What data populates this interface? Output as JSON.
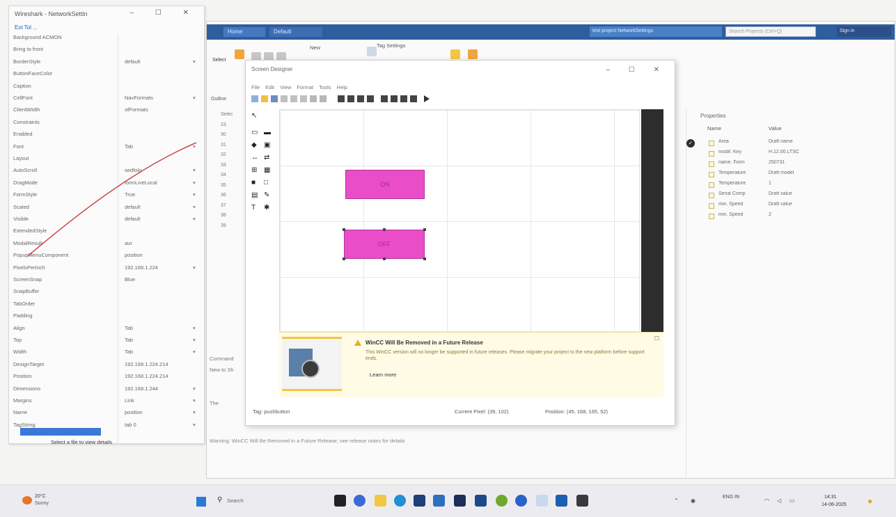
{
  "left_panel": {
    "title": "Wireshark - NetworkSettin",
    "path": "Ext Tol ...",
    "status": "Select a file to view details",
    "rows": [
      {
        "k": "Background ACMON",
        "v": "",
        "ar": ""
      },
      {
        "k": "Bring to front",
        "v": "",
        "ar": ""
      },
      {
        "k": "BorderStyle",
        "v": "default",
        "ar": "▾"
      },
      {
        "k": "ButtonFaceColor",
        "v": "",
        "ar": ""
      },
      {
        "k": "Caption",
        "v": "",
        "ar": ""
      },
      {
        "k": "CellFont",
        "v": "NavFormats",
        "ar": "▾"
      },
      {
        "k": "ClientWidth",
        "v": "ofFormats",
        "ar": ""
      },
      {
        "k": "Constraints",
        "v": "",
        "ar": ""
      },
      {
        "k": "Enabled",
        "v": "",
        "ar": ""
      },
      {
        "k": "Font",
        "v": "Tab",
        "ar": "▾"
      },
      {
        "k": "Layout",
        "v": "",
        "ar": ""
      },
      {
        "k": "AutoScroll",
        "v": "sedfolg",
        "ar": "▾"
      },
      {
        "k": "DragMode",
        "v": "formLiveLocal",
        "ar": "▾"
      },
      {
        "k": "FormStyle",
        "v": "True",
        "ar": "▾"
      },
      {
        "k": "Scaled",
        "v": "default",
        "ar": "▾"
      },
      {
        "k": "Visible",
        "v": "default",
        "ar": "▾"
      },
      {
        "k": "ExtendedStyle",
        "v": "",
        "ar": ""
      },
      {
        "k": "ModalResult",
        "v": "aur",
        "ar": ""
      },
      {
        "k": "PopupMenuComponent",
        "v": "position",
        "ar": ""
      },
      {
        "k": "PixelsPerInch",
        "v": "192.168.1.224",
        "ar": "▾"
      },
      {
        "k": "ScreenSnap",
        "v": "Blue",
        "ar": ""
      },
      {
        "k": "SnapBuffer",
        "v": "",
        "ar": ""
      },
      {
        "k": "TabOrder",
        "v": "",
        "ar": ""
      },
      {
        "k": "Padding",
        "v": "",
        "ar": ""
      },
      {
        "k": "Align",
        "v": "Tab",
        "ar": "▾"
      },
      {
        "k": "Top",
        "v": "Tab",
        "ar": "▾"
      },
      {
        "k": "Width",
        "v": "Tab",
        "ar": "▾"
      },
      {
        "k": "DesignTarget",
        "v": "192.168.1.224.214",
        "ar": ""
      },
      {
        "k": "Position",
        "v": "192.168.1.224.214",
        "ar": ""
      },
      {
        "k": "Dimensions",
        "v": "192.168.1.244",
        "ar": "▾"
      },
      {
        "k": "Margins",
        "v": "Link",
        "ar": "▾"
      },
      {
        "k": "Name",
        "v": "position",
        "ar": "▾"
      },
      {
        "k": "TagString",
        "v": "tab 0",
        "ar": "▾"
      }
    ]
  },
  "main_window": {
    "tab_a": "Home",
    "tab_b": "Default",
    "path_label": "test project NetworkSettings",
    "search_placeholder": "Search Projects (Ctrl+Q)",
    "user_label": "Sign in",
    "ribbon_select": "Select",
    "ribbon_item_1": "New",
    "ribbon_item_2": "Tag Settings"
  },
  "outline": {
    "title": "Outline",
    "rows": [
      "Selec",
      "23",
      "30",
      "31",
      "32",
      "33",
      "34",
      "35",
      "36",
      "37",
      "38",
      "39"
    ]
  },
  "properties": {
    "title": "Properties",
    "header_name": "Name",
    "header_value": "Value",
    "rows": [
      {
        "k": "Area",
        "v": "Draft name"
      },
      {
        "k": "modif. Key",
        "v": "H.12.00.LTSC"
      },
      {
        "k": "name. Form",
        "v": "250731"
      },
      {
        "k": "Temperature",
        "v": "Draft model"
      },
      {
        "k": "Temperature",
        "v": "1"
      },
      {
        "k": "Serial Comp",
        "v": "Draft value"
      },
      {
        "k": "min. Speed",
        "v": "Draft value"
      },
      {
        "k": "min. Speed",
        "v": "2"
      }
    ]
  },
  "console": {
    "lines": [
      "Command",
      "New to Sh",
      "",
      "",
      "The",
      "",
      "",
      ""
    ],
    "long_line": "Warning: WinCC Will Be Removed in a Future Release; see release notes for details"
  },
  "designer": {
    "title": "Screen Designer",
    "menu": "File Edit View Format Tools Help",
    "btn_on": "ON",
    "btn_off": "OFF",
    "notice_title": "WinCC Will Be Removed in a Future Release",
    "notice_body": "This WinCC version will no longer be supported in future releases. Please migrate your project to the new platform before support ends.",
    "notice_link": "Learn more",
    "status_left": "Tag: pushbutton",
    "status_mid": "Current Pixel: (39, 102)",
    "status_right": "Position: (45, 168, 165, 52)"
  },
  "taskbar": {
    "weather_temp": "20°C",
    "weather_desc": "Sunny",
    "search_label": "Search",
    "tray_lang": "ENG IN",
    "time": "14:31",
    "date": "14-06-2025"
  },
  "colors": {
    "title_bar": "#2f5d9e",
    "pink_button": "#e94ec8",
    "notice_bg": "#fffbe5"
  }
}
